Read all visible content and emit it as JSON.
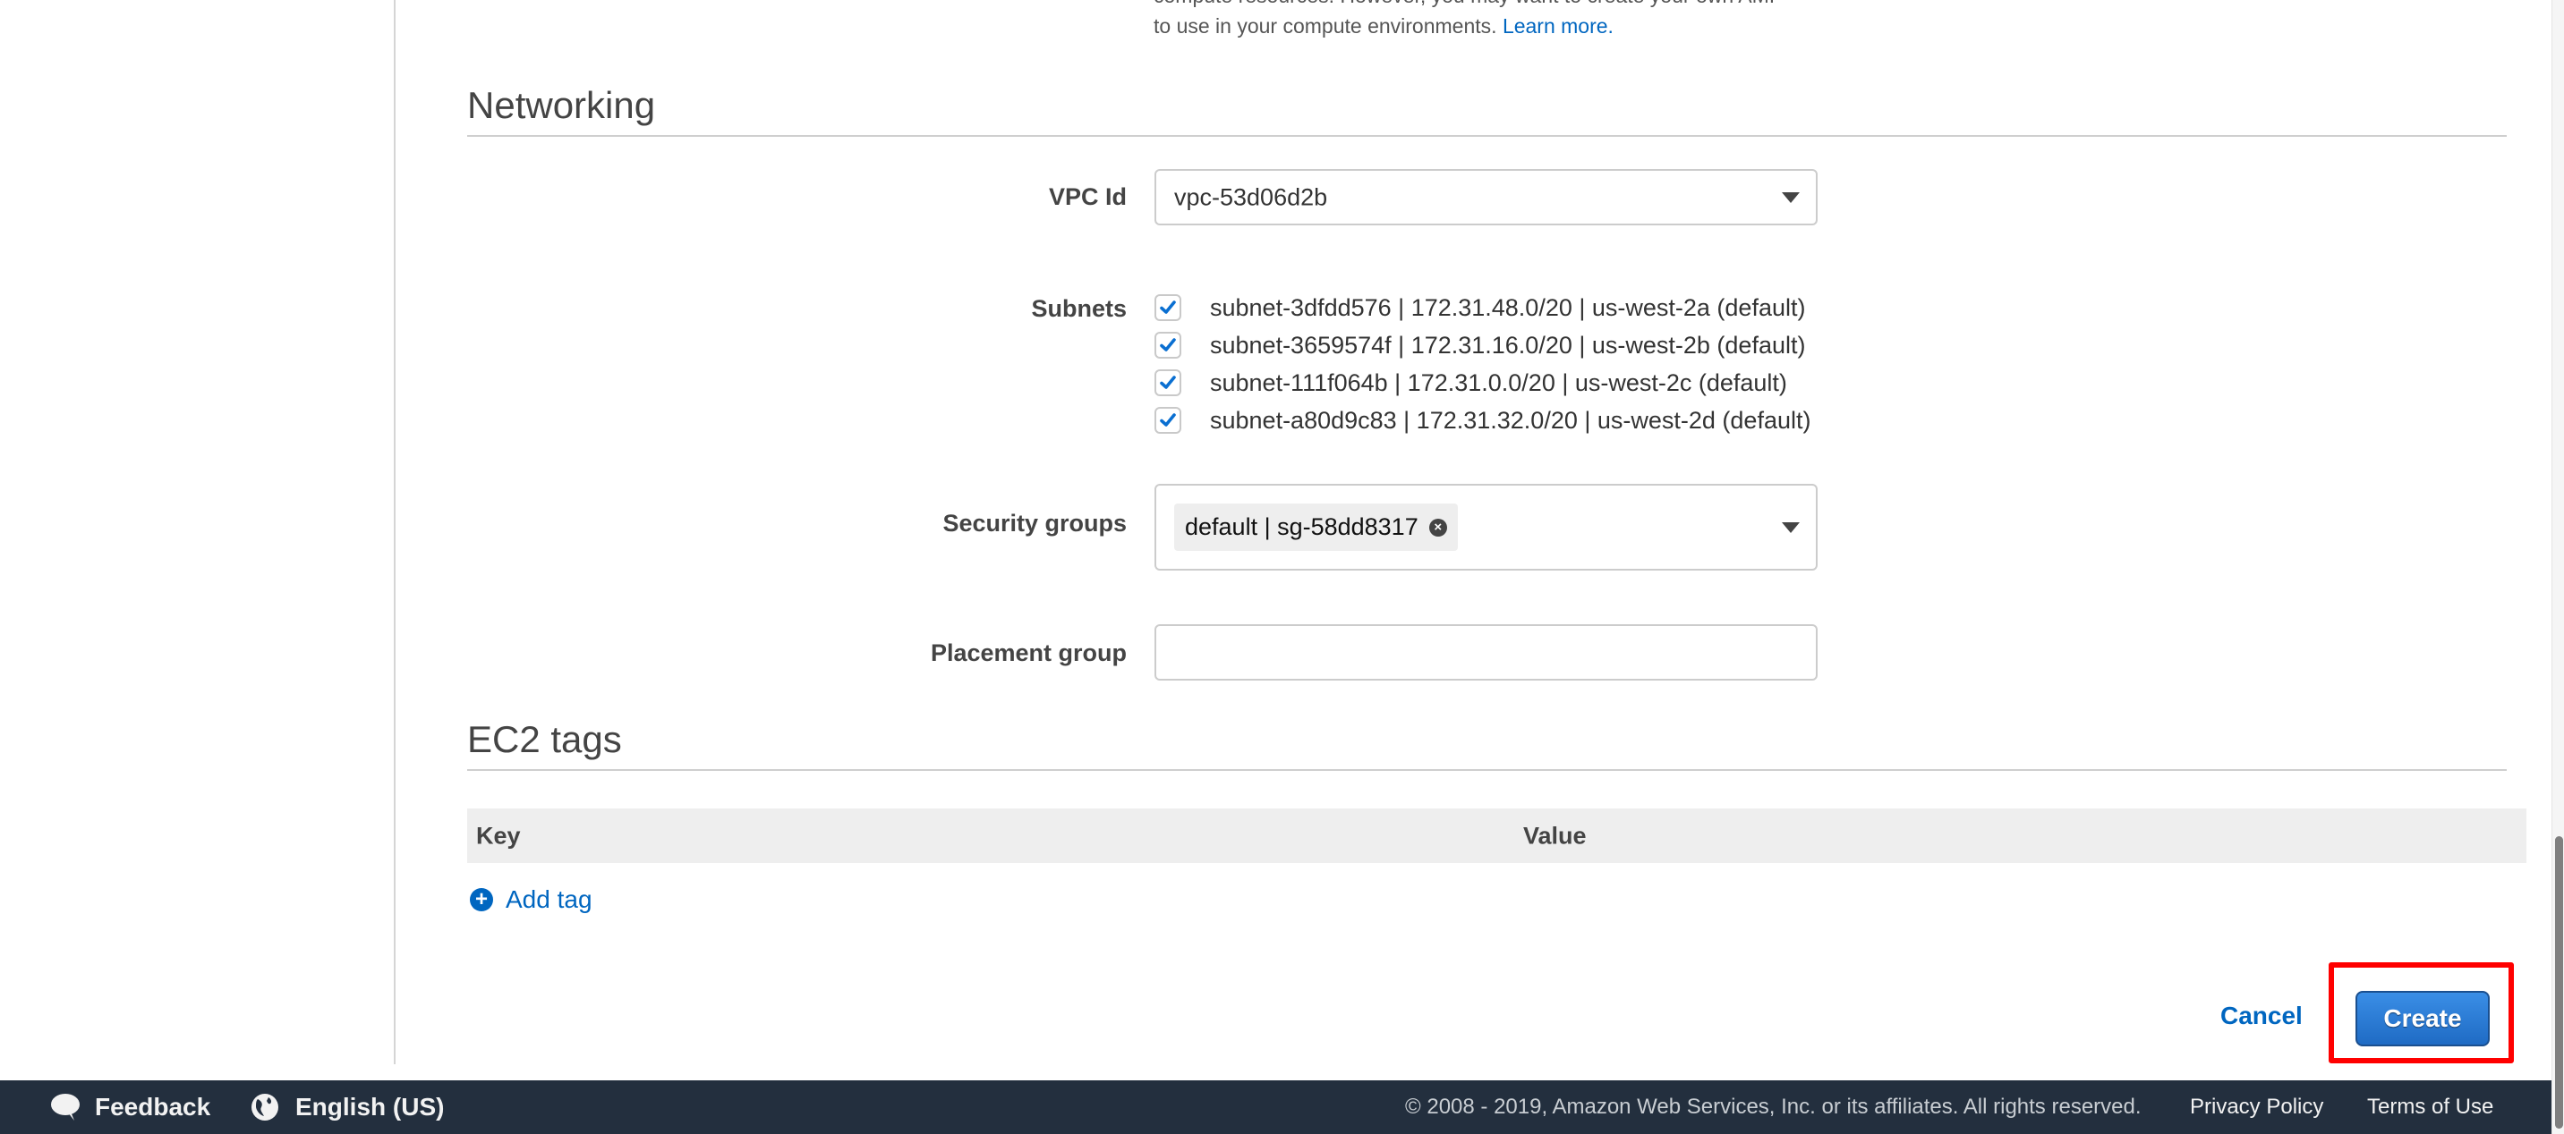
{
  "intro": {
    "line1": "compute resources. However, you may want to create your own AMI",
    "line2": "to use in your compute environments.",
    "learn_more": "Learn more."
  },
  "networking": {
    "title": "Networking",
    "vpc": {
      "label": "VPC Id",
      "value": "vpc-53d06d2b"
    },
    "subnets": {
      "label": "Subnets",
      "items": [
        {
          "text": "subnet-3dfdd576 | 172.31.48.0/20 | us-west-2a (default)",
          "checked": true
        },
        {
          "text": "subnet-3659574f | 172.31.16.0/20 | us-west-2b (default)",
          "checked": true
        },
        {
          "text": "subnet-111f064b | 172.31.0.0/20 | us-west-2c (default)",
          "checked": true
        },
        {
          "text": "subnet-a80d9c83 | 172.31.32.0/20 | us-west-2d (default)",
          "checked": true
        }
      ]
    },
    "security_groups": {
      "label": "Security groups",
      "selected": [
        "default | sg-58dd8317"
      ]
    },
    "placement_group": {
      "label": "Placement group",
      "value": ""
    }
  },
  "ec2_tags": {
    "title": "EC2 tags",
    "columns": [
      "Key",
      "Value"
    ],
    "add_tag": "Add tag"
  },
  "actions": {
    "cancel": "Cancel",
    "create": "Create"
  },
  "footer": {
    "feedback": "Feedback",
    "language": "English (US)",
    "copyright": "© 2008 - 2019, Amazon Web Services, Inc. or its affiliates. All rights reserved.",
    "privacy": "Privacy Policy",
    "terms": "Terms of Use"
  },
  "colors": {
    "link": "#0066c0",
    "primary_button": "#1f6bc4",
    "highlight": "#ff0000",
    "footer_bg": "#232f3e"
  }
}
